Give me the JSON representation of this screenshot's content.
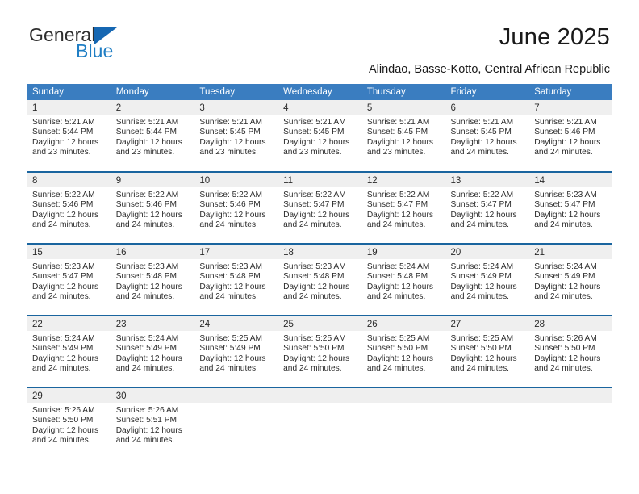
{
  "brand": {
    "name_part1": "General",
    "name_part2": "Blue",
    "logo_icon": "triangle-logo-icon",
    "accent_color": "#1667b2",
    "blue_text_color": "#1f7ec4"
  },
  "header": {
    "title": "June 2025",
    "subtitle": "Alindao, Basse-Kotto, Central African Republic"
  },
  "colors": {
    "header_row_bg": "#3a7dc0",
    "row_divider": "#1a659f",
    "daynum_band_bg": "#efefef",
    "text": "#2b2b2b"
  },
  "weekday_headers": [
    "Sunday",
    "Monday",
    "Tuesday",
    "Wednesday",
    "Thursday",
    "Friday",
    "Saturday"
  ],
  "weeks": [
    [
      {
        "day": "1",
        "sunrise": "Sunrise: 5:21 AM",
        "sunset": "Sunset: 5:44 PM",
        "daylight": "Daylight: 12 hours and 23 minutes."
      },
      {
        "day": "2",
        "sunrise": "Sunrise: 5:21 AM",
        "sunset": "Sunset: 5:44 PM",
        "daylight": "Daylight: 12 hours and 23 minutes."
      },
      {
        "day": "3",
        "sunrise": "Sunrise: 5:21 AM",
        "sunset": "Sunset: 5:45 PM",
        "daylight": "Daylight: 12 hours and 23 minutes."
      },
      {
        "day": "4",
        "sunrise": "Sunrise: 5:21 AM",
        "sunset": "Sunset: 5:45 PM",
        "daylight": "Daylight: 12 hours and 23 minutes."
      },
      {
        "day": "5",
        "sunrise": "Sunrise: 5:21 AM",
        "sunset": "Sunset: 5:45 PM",
        "daylight": "Daylight: 12 hours and 23 minutes."
      },
      {
        "day": "6",
        "sunrise": "Sunrise: 5:21 AM",
        "sunset": "Sunset: 5:45 PM",
        "daylight": "Daylight: 12 hours and 24 minutes."
      },
      {
        "day": "7",
        "sunrise": "Sunrise: 5:21 AM",
        "sunset": "Sunset: 5:46 PM",
        "daylight": "Daylight: 12 hours and 24 minutes."
      }
    ],
    [
      {
        "day": "8",
        "sunrise": "Sunrise: 5:22 AM",
        "sunset": "Sunset: 5:46 PM",
        "daylight": "Daylight: 12 hours and 24 minutes."
      },
      {
        "day": "9",
        "sunrise": "Sunrise: 5:22 AM",
        "sunset": "Sunset: 5:46 PM",
        "daylight": "Daylight: 12 hours and 24 minutes."
      },
      {
        "day": "10",
        "sunrise": "Sunrise: 5:22 AM",
        "sunset": "Sunset: 5:46 PM",
        "daylight": "Daylight: 12 hours and 24 minutes."
      },
      {
        "day": "11",
        "sunrise": "Sunrise: 5:22 AM",
        "sunset": "Sunset: 5:47 PM",
        "daylight": "Daylight: 12 hours and 24 minutes."
      },
      {
        "day": "12",
        "sunrise": "Sunrise: 5:22 AM",
        "sunset": "Sunset: 5:47 PM",
        "daylight": "Daylight: 12 hours and 24 minutes."
      },
      {
        "day": "13",
        "sunrise": "Sunrise: 5:22 AM",
        "sunset": "Sunset: 5:47 PM",
        "daylight": "Daylight: 12 hours and 24 minutes."
      },
      {
        "day": "14",
        "sunrise": "Sunrise: 5:23 AM",
        "sunset": "Sunset: 5:47 PM",
        "daylight": "Daylight: 12 hours and 24 minutes."
      }
    ],
    [
      {
        "day": "15",
        "sunrise": "Sunrise: 5:23 AM",
        "sunset": "Sunset: 5:47 PM",
        "daylight": "Daylight: 12 hours and 24 minutes."
      },
      {
        "day": "16",
        "sunrise": "Sunrise: 5:23 AM",
        "sunset": "Sunset: 5:48 PM",
        "daylight": "Daylight: 12 hours and 24 minutes."
      },
      {
        "day": "17",
        "sunrise": "Sunrise: 5:23 AM",
        "sunset": "Sunset: 5:48 PM",
        "daylight": "Daylight: 12 hours and 24 minutes."
      },
      {
        "day": "18",
        "sunrise": "Sunrise: 5:23 AM",
        "sunset": "Sunset: 5:48 PM",
        "daylight": "Daylight: 12 hours and 24 minutes."
      },
      {
        "day": "19",
        "sunrise": "Sunrise: 5:24 AM",
        "sunset": "Sunset: 5:48 PM",
        "daylight": "Daylight: 12 hours and 24 minutes."
      },
      {
        "day": "20",
        "sunrise": "Sunrise: 5:24 AM",
        "sunset": "Sunset: 5:49 PM",
        "daylight": "Daylight: 12 hours and 24 minutes."
      },
      {
        "day": "21",
        "sunrise": "Sunrise: 5:24 AM",
        "sunset": "Sunset: 5:49 PM",
        "daylight": "Daylight: 12 hours and 24 minutes."
      }
    ],
    [
      {
        "day": "22",
        "sunrise": "Sunrise: 5:24 AM",
        "sunset": "Sunset: 5:49 PM",
        "daylight": "Daylight: 12 hours and 24 minutes."
      },
      {
        "day": "23",
        "sunrise": "Sunrise: 5:24 AM",
        "sunset": "Sunset: 5:49 PM",
        "daylight": "Daylight: 12 hours and 24 minutes."
      },
      {
        "day": "24",
        "sunrise": "Sunrise: 5:25 AM",
        "sunset": "Sunset: 5:49 PM",
        "daylight": "Daylight: 12 hours and 24 minutes."
      },
      {
        "day": "25",
        "sunrise": "Sunrise: 5:25 AM",
        "sunset": "Sunset: 5:50 PM",
        "daylight": "Daylight: 12 hours and 24 minutes."
      },
      {
        "day": "26",
        "sunrise": "Sunrise: 5:25 AM",
        "sunset": "Sunset: 5:50 PM",
        "daylight": "Daylight: 12 hours and 24 minutes."
      },
      {
        "day": "27",
        "sunrise": "Sunrise: 5:25 AM",
        "sunset": "Sunset: 5:50 PM",
        "daylight": "Daylight: 12 hours and 24 minutes."
      },
      {
        "day": "28",
        "sunrise": "Sunrise: 5:26 AM",
        "sunset": "Sunset: 5:50 PM",
        "daylight": "Daylight: 12 hours and 24 minutes."
      }
    ],
    [
      {
        "day": "29",
        "sunrise": "Sunrise: 5:26 AM",
        "sunset": "Sunset: 5:50 PM",
        "daylight": "Daylight: 12 hours and 24 minutes."
      },
      {
        "day": "30",
        "sunrise": "Sunrise: 5:26 AM",
        "sunset": "Sunset: 5:51 PM",
        "daylight": "Daylight: 12 hours and 24 minutes."
      },
      {
        "day": "",
        "sunrise": "",
        "sunset": "",
        "daylight": ""
      },
      {
        "day": "",
        "sunrise": "",
        "sunset": "",
        "daylight": ""
      },
      {
        "day": "",
        "sunrise": "",
        "sunset": "",
        "daylight": ""
      },
      {
        "day": "",
        "sunrise": "",
        "sunset": "",
        "daylight": ""
      },
      {
        "day": "",
        "sunrise": "",
        "sunset": "",
        "daylight": ""
      }
    ]
  ]
}
